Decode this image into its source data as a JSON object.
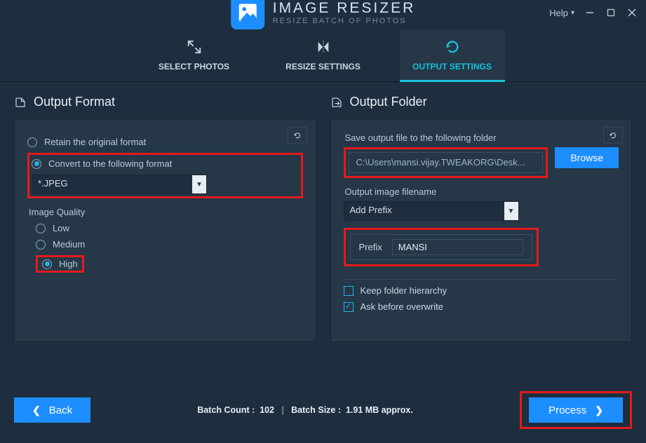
{
  "app": {
    "title": "IMAGE RESIZER",
    "subtitle": "RESIZE BATCH OF PHOTOS",
    "help_label": "Help"
  },
  "tabs": {
    "select": "SELECT PHOTOS",
    "resize": "RESIZE SETTINGS",
    "output": "OUTPUT SETTINGS"
  },
  "format_panel": {
    "header": "Output Format",
    "retain_label": "Retain the original format",
    "convert_label": "Convert to the following format",
    "selected_format": "*.JPEG",
    "quality_header": "Image Quality",
    "low": "Low",
    "medium": "Medium",
    "high": "High"
  },
  "folder_panel": {
    "header": "Output Folder",
    "save_label": "Save output file to the following folder",
    "path": "C:\\Users\\mansi.vijay.TWEAKORG\\Desk...",
    "browse": "Browse",
    "filename_label": "Output image filename",
    "filename_mode": "Add Prefix",
    "prefix_label": "Prefix",
    "prefix_value": "MANSI",
    "keep_hierarchy": "Keep folder hierarchy",
    "ask_overwrite": "Ask before overwrite"
  },
  "footer": {
    "back": "Back",
    "batch_count_label": "Batch Count :",
    "batch_count": "102",
    "batch_size_label": "Batch Size :",
    "batch_size": "1.91 MB approx.",
    "process": "Process"
  }
}
